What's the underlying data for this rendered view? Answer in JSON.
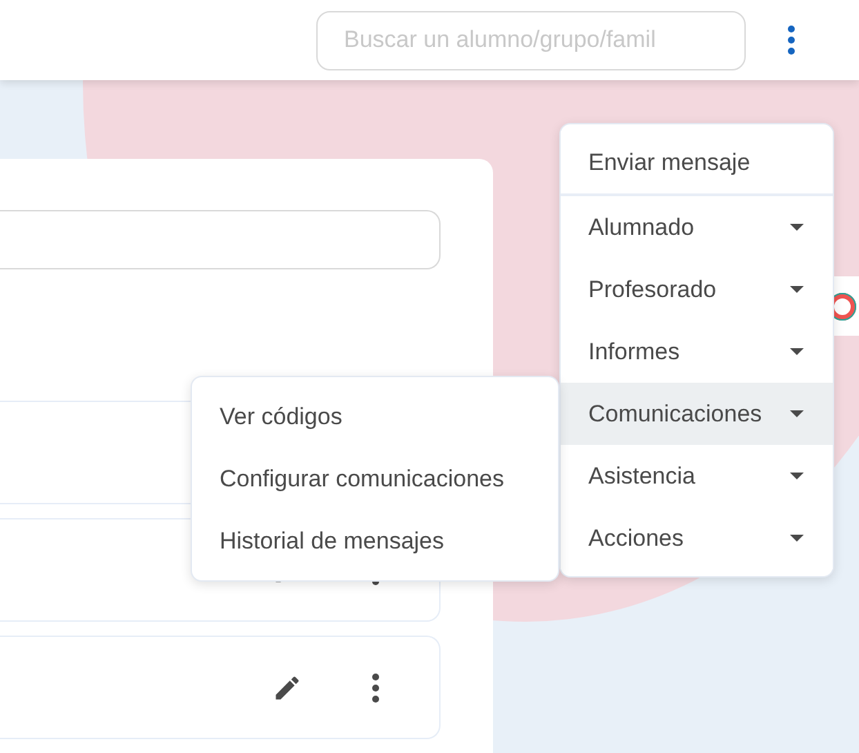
{
  "header": {
    "search": {
      "placeholder": "Buscar un alumno/grupo/famil"
    }
  },
  "content": {
    "rows": [
      {
        "kind": "plain"
      },
      {
        "kind": "actions"
      },
      {
        "kind": "actions"
      }
    ]
  },
  "menu": {
    "items": [
      {
        "label": "Enviar mensaje",
        "kind": "action",
        "selected": false
      },
      {
        "label": "Alumnado",
        "kind": "submenu",
        "selected": false
      },
      {
        "label": "Profesorado",
        "kind": "submenu",
        "selected": false
      },
      {
        "label": "Informes",
        "kind": "submenu",
        "selected": false
      },
      {
        "label": "Comunicaciones",
        "kind": "submenu",
        "selected": true
      },
      {
        "label": "Asistencia",
        "kind": "submenu",
        "selected": false
      },
      {
        "label": "Acciones",
        "kind": "submenu",
        "selected": false
      }
    ]
  },
  "submenu": {
    "items": [
      {
        "label": "Ver códigos"
      },
      {
        "label": "Configurar comunicaciones"
      },
      {
        "label": "Historial de mensajes"
      }
    ]
  }
}
